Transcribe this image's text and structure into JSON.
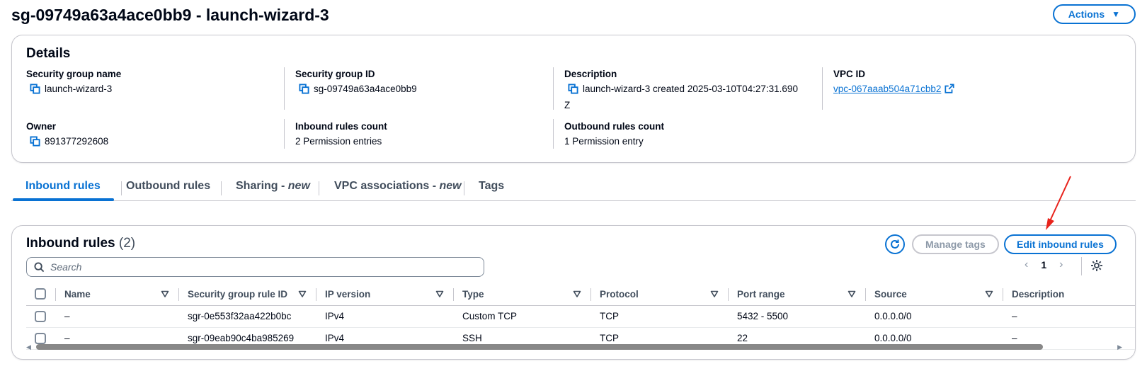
{
  "header": {
    "title": "sg-09749a63a4ace0bb9 - launch-wizard-3",
    "actions_label": "Actions"
  },
  "details": {
    "title": "Details",
    "sg_name_label": "Security group name",
    "sg_name_value": "launch-wizard-3",
    "sg_id_label": "Security group ID",
    "sg_id_value": "sg-09749a63a4ace0bb9",
    "description_label": "Description",
    "description_value_line1": "launch-wizard-3 created 2025-03-10T04:27:31.690",
    "description_value_line2": "Z",
    "vpc_id_label": "VPC ID",
    "vpc_id_value": "vpc-067aaab504a71cbb2",
    "owner_label": "Owner",
    "owner_value": "891377292608",
    "inbound_count_label": "Inbound rules count",
    "inbound_count_value": "2 Permission entries",
    "outbound_count_label": "Outbound rules count",
    "outbound_count_value": "1 Permission entry"
  },
  "tabs": [
    {
      "label": "Inbound rules",
      "active": true
    },
    {
      "label": "Outbound rules",
      "active": false
    },
    {
      "label": "Sharing - ",
      "suffix": "new",
      "active": false
    },
    {
      "label": "VPC associations - ",
      "suffix": "new",
      "active": false
    },
    {
      "label": "Tags",
      "active": false
    }
  ],
  "inbound": {
    "title": "Inbound rules",
    "count": "(2)",
    "manage_tags_label": "Manage tags",
    "edit_label": "Edit inbound rules",
    "search_placeholder": "Search",
    "page": "1",
    "columns": [
      "Name",
      "Security group rule ID",
      "IP version",
      "Type",
      "Protocol",
      "Port range",
      "Source",
      "Description"
    ],
    "rows": [
      {
        "name": "–",
        "rule_id": "sgr-0e553f32aa422b0bc",
        "ip_version": "IPv4",
        "type": "Custom TCP",
        "protocol": "TCP",
        "port_range": "5432 - 5500",
        "source": "0.0.0.0/0",
        "description": "–"
      },
      {
        "name": "–",
        "rule_id": "sgr-09eab90c4ba985269",
        "ip_version": "IPv4",
        "type": "SSH",
        "protocol": "TCP",
        "port_range": "22",
        "source": "0.0.0.0/0",
        "description": "–"
      }
    ]
  },
  "colors": {
    "accent": "#0972d3",
    "annotation_arrow": "#e8231c",
    "border": "#c6c6cd"
  },
  "icons": {
    "copy": "copy-icon",
    "external_link": "external-link-icon",
    "refresh": "refresh-icon",
    "search": "search-icon",
    "settings": "gear-icon",
    "sort": "caret-down-icon"
  }
}
